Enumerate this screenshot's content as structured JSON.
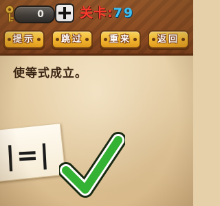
{
  "header": {
    "hint_counter": "0",
    "level_label": "关卡:",
    "level_number": "79"
  },
  "menu": [
    {
      "label": "提示"
    },
    {
      "label": "跳过"
    },
    {
      "label": "重来"
    },
    {
      "label": "返回"
    }
  ],
  "puzzle": {
    "instruction": "使等式成立。",
    "equation": "|=|"
  },
  "icons": {
    "key": "key-icon",
    "plus": "plus-icon",
    "check": "checkmark-icon"
  },
  "colors": {
    "header_bg": "#8a4a22",
    "button_yellow": "#f0b530",
    "level_label": "#ff3b2e",
    "level_number": "#3ec8ff",
    "check_green": "#34b233"
  }
}
